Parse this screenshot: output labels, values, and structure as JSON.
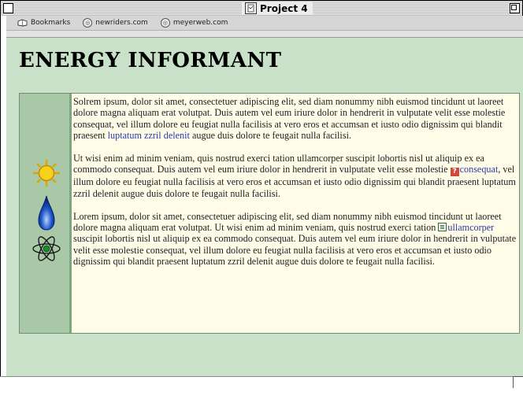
{
  "window": {
    "title": "Project 4"
  },
  "toolbar": {
    "items": [
      {
        "label": "Bookmarks",
        "icon": "bookmarks-icon"
      },
      {
        "label": "newriders.com",
        "icon": "globe-icon"
      },
      {
        "label": "meyerweb.com",
        "icon": "globe-icon"
      }
    ]
  },
  "page": {
    "heading": "ENERGY INFORMANT",
    "side_icons": [
      "sun-icon",
      "flame-icon",
      "atom-icon"
    ],
    "paragraphs": [
      {
        "before": "Solrem ipsum, dolor sit amet, consectetuer adipiscing elit, sed diam nonummy nibh euismod tincidunt ut laoreet dolore magna aliquam erat volutpat. Duis autem vel eum iriure dolor in hendrerit in vulputate velit esse molestie consequat, vel illum dolore eu feugiat nulla facilisis at vero eros et accumsan et iusto odio dignissim qui blandit praesent ",
        "link": "luptatum zzril delenit",
        "after": " augue duis dolore te feugait nulla facilisi."
      },
      {
        "before": "Ut wisi enim ad minim veniam, quis nostrud exerci tation ullamcorper suscipit lobortis nisl ut aliquip ex ea commodo consequat. Duis autem vel eum iriure dolor in hendrerit in vulputate velit esse molestie ",
        "link": "consequat",
        "after": ", vel illum dolore eu feugiat nulla facilisis at vero eros et accumsan et iusto odio dignissim qui blandit praesent luptatum zzril delenit augue duis dolore te feugait nulla facilisi."
      },
      {
        "before": "Lorem ipsum, dolor sit amet, consectetuer adipiscing elit, sed diam nonummy nibh euismod tincidunt ut laoreet dolore magna aliquam erat volutpat. Ut wisi enim ad minim veniam, quis nostrud exerci tation ",
        "link": "ullamcorper",
        "after": " suscipit lobortis nisl ut aliquip ex ea commodo consequat. Duis autem vel eum iriure dolor in hendrerit in vulputate velit esse molestie consequat, vel illum dolore eu feugiat nulla facilisis at vero eros et accumsan et iusto odio dignissim qui blandit praesent luptatum zzril delenit augue duis dolore te feugait nulla facilisi."
      }
    ]
  },
  "colors": {
    "page_background": "#c9e0c9",
    "sidebar": "#a8c8a8",
    "text_box": "#fffde8",
    "link": "#2c3aa8"
  }
}
